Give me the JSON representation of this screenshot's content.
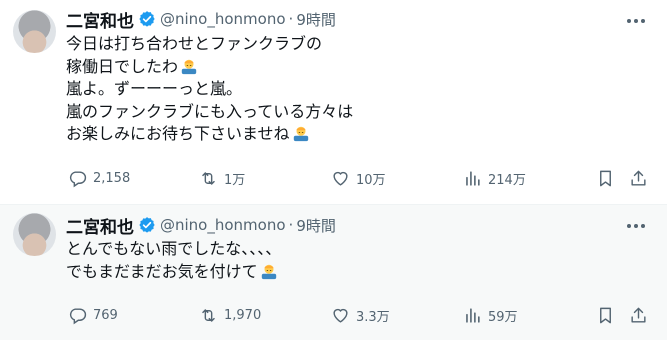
{
  "tweets": [
    {
      "author": {
        "name": "二宮和也",
        "handle": "@nino_honmono",
        "time": "9時間",
        "avatar_icon": "avatar-photo"
      },
      "lines": [
        "今日は打ち合わせとファンクラブの",
        "稼働日でしたわ",
        "嵐よ。ずーーーっと嵐。",
        "嵐のファンクラブにも入っている方々は",
        "お楽しみにお待ち下さいませね"
      ],
      "emoji_icon": "person-bowing-emoji",
      "stats": {
        "replies": "2,158",
        "retweets": "1万",
        "likes": "10万",
        "views": "214万"
      }
    },
    {
      "author": {
        "name": "二宮和也",
        "handle": "@nino_honmono",
        "time": "9時間",
        "avatar_icon": "avatar-photo"
      },
      "lines": [
        "とんでもない雨でしたな、、、、",
        "でもまだまだお気を付けて"
      ],
      "emoji_icon": "person-bowing-emoji",
      "stats": {
        "replies": "769",
        "retweets": "1,970",
        "likes": "3.3万",
        "views": "59万"
      }
    }
  ],
  "colors": {
    "text": "#0f1419",
    "muted": "#536471",
    "verified": "#1d9bf0",
    "divider": "#eff3f4",
    "hover_bg": "#f7f9f9"
  },
  "icons": [
    "reply-icon",
    "retweet-icon",
    "like-icon",
    "views-icon",
    "bookmark-icon",
    "share-icon",
    "more-icon",
    "verified-badge-icon"
  ]
}
